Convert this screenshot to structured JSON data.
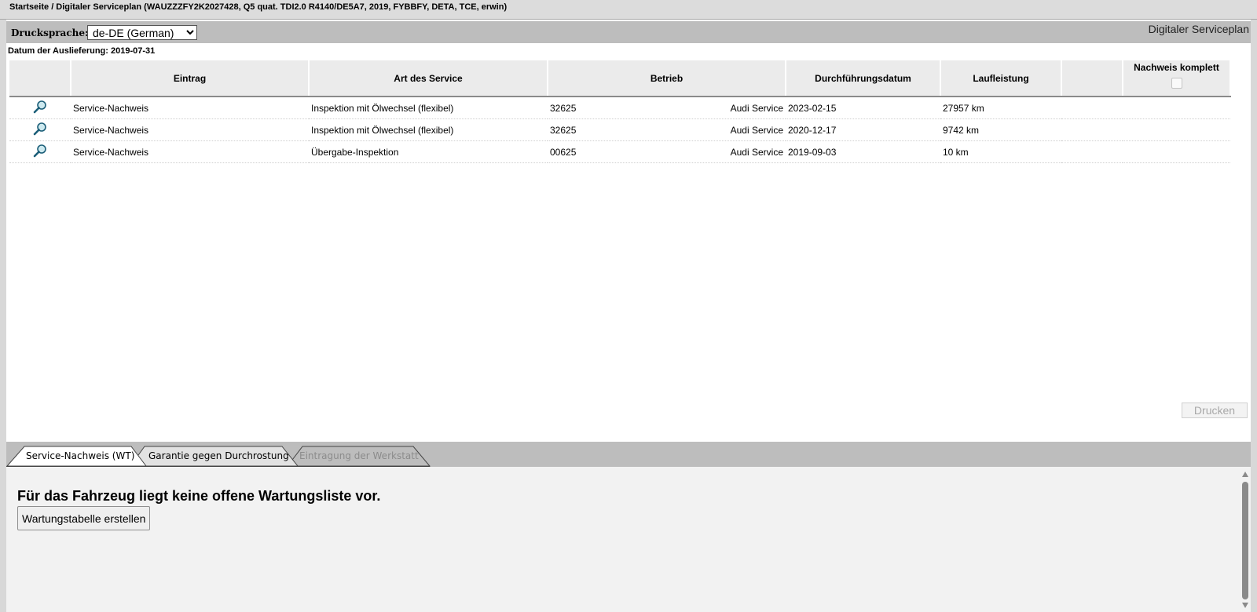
{
  "breadcrumb": "Startseite / Digitaler Serviceplan (WAUZZZFY2K2027428, Q5 quat. TDI2.0 R4140/DE5A7, 2019, FYBBFY, DETA, TCE, erwin)",
  "toolbar": {
    "language_label": "Drucksprache:",
    "language_value": "de-DE (German)",
    "page_title": "Digitaler Serviceplan"
  },
  "delivery_date": "Datum der Auslieferung: 2019-07-31",
  "table": {
    "headers": {
      "eintrag": "Eintrag",
      "art": "Art des Service",
      "betrieb": "Betrieb",
      "datum": "Durchführungsdatum",
      "laufleistung": "Laufleistung",
      "empty": "",
      "nachweis": "Nachweis komplett"
    },
    "rows": [
      {
        "eintrag": "Service-Nachweis",
        "art": "Inspektion mit Ölwechsel (flexibel)",
        "betrieb_nr": "32625",
        "betrieb_name": "Audi Service",
        "datum": "2023-02-15",
        "laufleistung": "27957 km"
      },
      {
        "eintrag": "Service-Nachweis",
        "art": "Inspektion mit Ölwechsel (flexibel)",
        "betrieb_nr": "32625",
        "betrieb_name": "Audi Service",
        "datum": "2020-12-17",
        "laufleistung": "9742 km"
      },
      {
        "eintrag": "Service-Nachweis",
        "art": "Übergabe-Inspektion",
        "betrieb_nr": "00625",
        "betrieb_name": "Audi Service",
        "datum": "2019-09-03",
        "laufleistung": "10 km"
      }
    ]
  },
  "print_button": "Drucken",
  "tabs": [
    {
      "label": "Service-Nachweis (WT)",
      "state": "active"
    },
    {
      "label": "Garantie gegen Durchrostung",
      "state": "normal"
    },
    {
      "label": "Eintragung der Werkstatt",
      "state": "disabled"
    }
  ],
  "content": {
    "message": "Für das Fahrzeug liegt keine offene Wartungsliste vor.",
    "create_button": "Wartungstabelle erstellen"
  },
  "icons": {
    "row_detail": "magnifier-icon"
  },
  "colors": {
    "header_bar": "#bdbdbd",
    "table_header": "#ebebeb",
    "content_bg": "#f2f2f2"
  }
}
